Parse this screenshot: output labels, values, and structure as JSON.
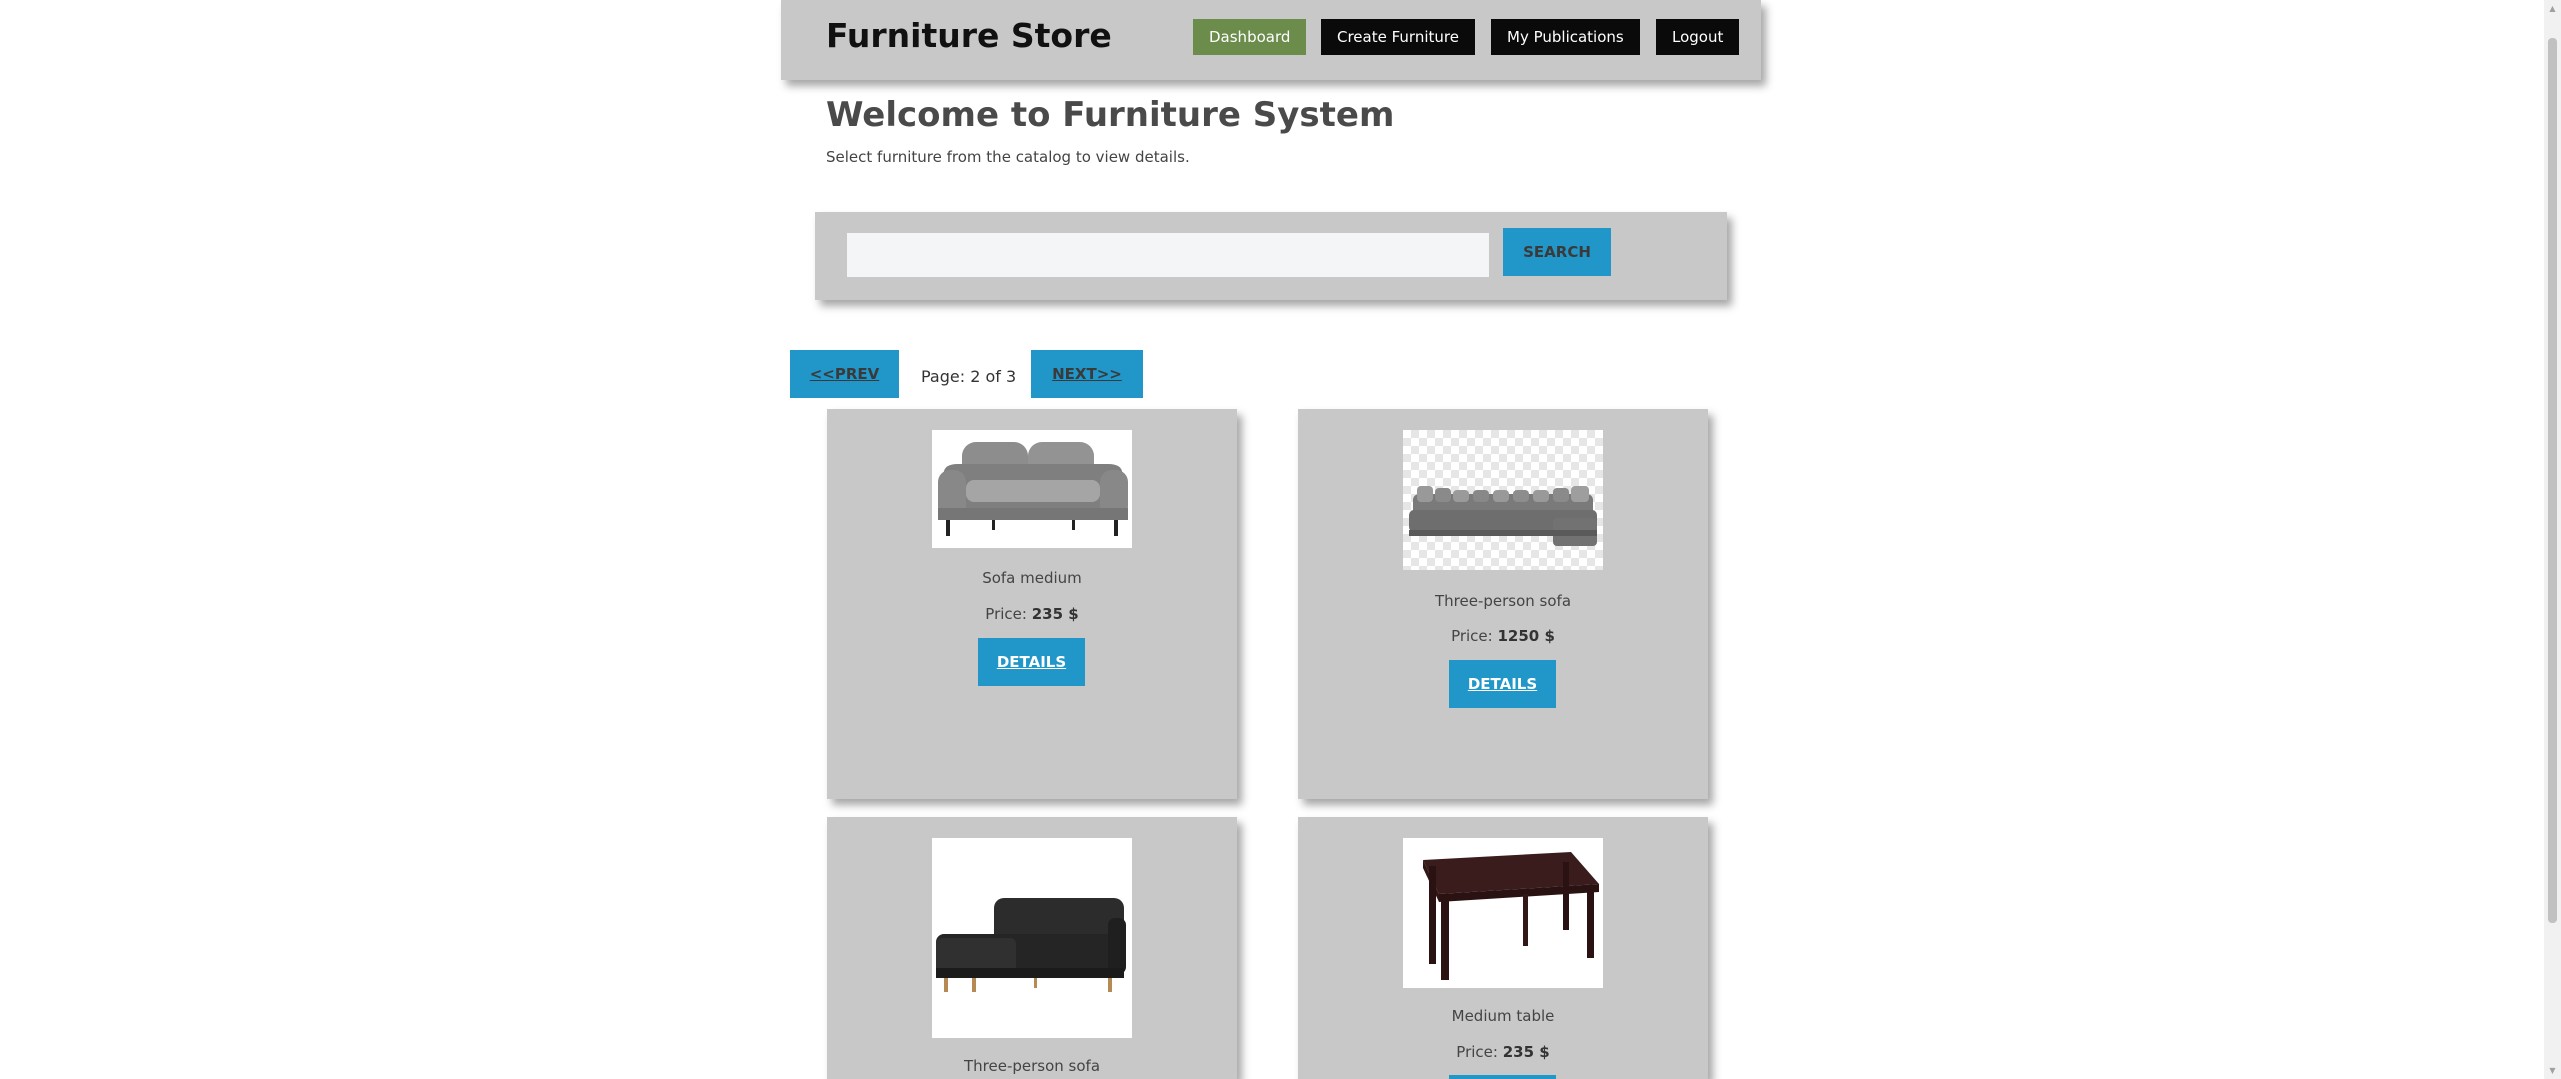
{
  "header": {
    "logo": "Furniture Store",
    "nav": [
      {
        "label": "Dashboard"
      },
      {
        "label": "Create Furniture"
      },
      {
        "label": "My Publications"
      },
      {
        "label": "Logout"
      }
    ]
  },
  "welcome": {
    "title": "Welcome to Furniture System",
    "subtitle": "Select furniture from the catalog to view details."
  },
  "search": {
    "value": "",
    "button_label": "SEARCH"
  },
  "pagination": {
    "prev_label": "<<PREV",
    "info": "Page: 2 of 3",
    "next_label": "NEXT>>"
  },
  "items": [
    {
      "name": "Sofa medium",
      "price_label": "Price:",
      "price": "235 $",
      "details_label": "DETAILS",
      "image": "gray-sofa"
    },
    {
      "name": "Three-person sofa",
      "price_label": "Price:",
      "price": "1250 $",
      "details_label": "DETAILS",
      "image": "sectional-sofa"
    },
    {
      "name": "Three-person sofa",
      "image": "black-corner-sofa"
    },
    {
      "name": "Medium table",
      "price_label": "Price:",
      "price": "235 $",
      "image": "dark-wood-table"
    }
  ],
  "colors": {
    "panel": "#c8c8c8",
    "accent": "#2196c9",
    "active_nav": "#6b8c4a",
    "nav": "#0a0a0a"
  }
}
